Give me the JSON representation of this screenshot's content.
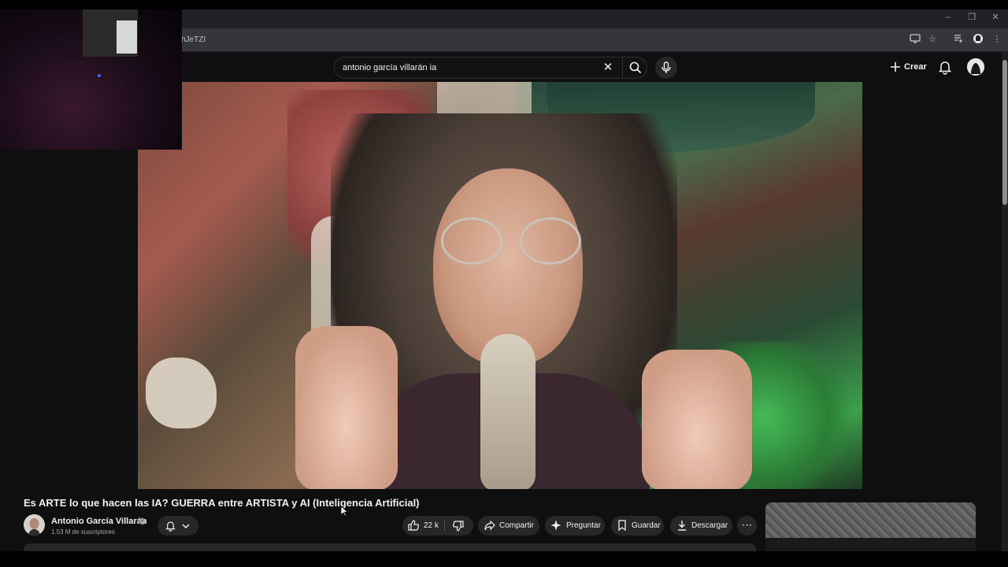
{
  "browser": {
    "url_fragment": "hJeTZI",
    "window_controls": [
      "minimize",
      "restore",
      "close"
    ]
  },
  "masthead": {
    "search_query": "antonio garcía villarán ia",
    "create_label": "Crear"
  },
  "video": {
    "title": "Es ARTE lo que hacen las IA? GUERRA entre ARTISTA y AI (Inteligencia Artificial)",
    "channel_name": "Antonio García Villarán",
    "subscribers": "1.53 M de suscriptores",
    "likes": "22 k"
  },
  "actions": {
    "share": "Compartir",
    "ask": "Preguntar",
    "save": "Guardar",
    "download": "Descargar"
  },
  "colors": {
    "background": "#0f0f0f",
    "pill": "#272727",
    "text": "#f1f1f1",
    "muted": "#aaaaaa"
  },
  "icons": [
    "search-icon",
    "clear-icon",
    "mic-icon",
    "plus-icon",
    "bell-icon",
    "like-icon",
    "dislike-icon",
    "share-icon",
    "sparkle-icon",
    "bookmark-icon",
    "download-icon",
    "more-icon",
    "verified-icon",
    "chevron-down-icon",
    "cast-icon",
    "star-icon",
    "extensions-icon"
  ]
}
